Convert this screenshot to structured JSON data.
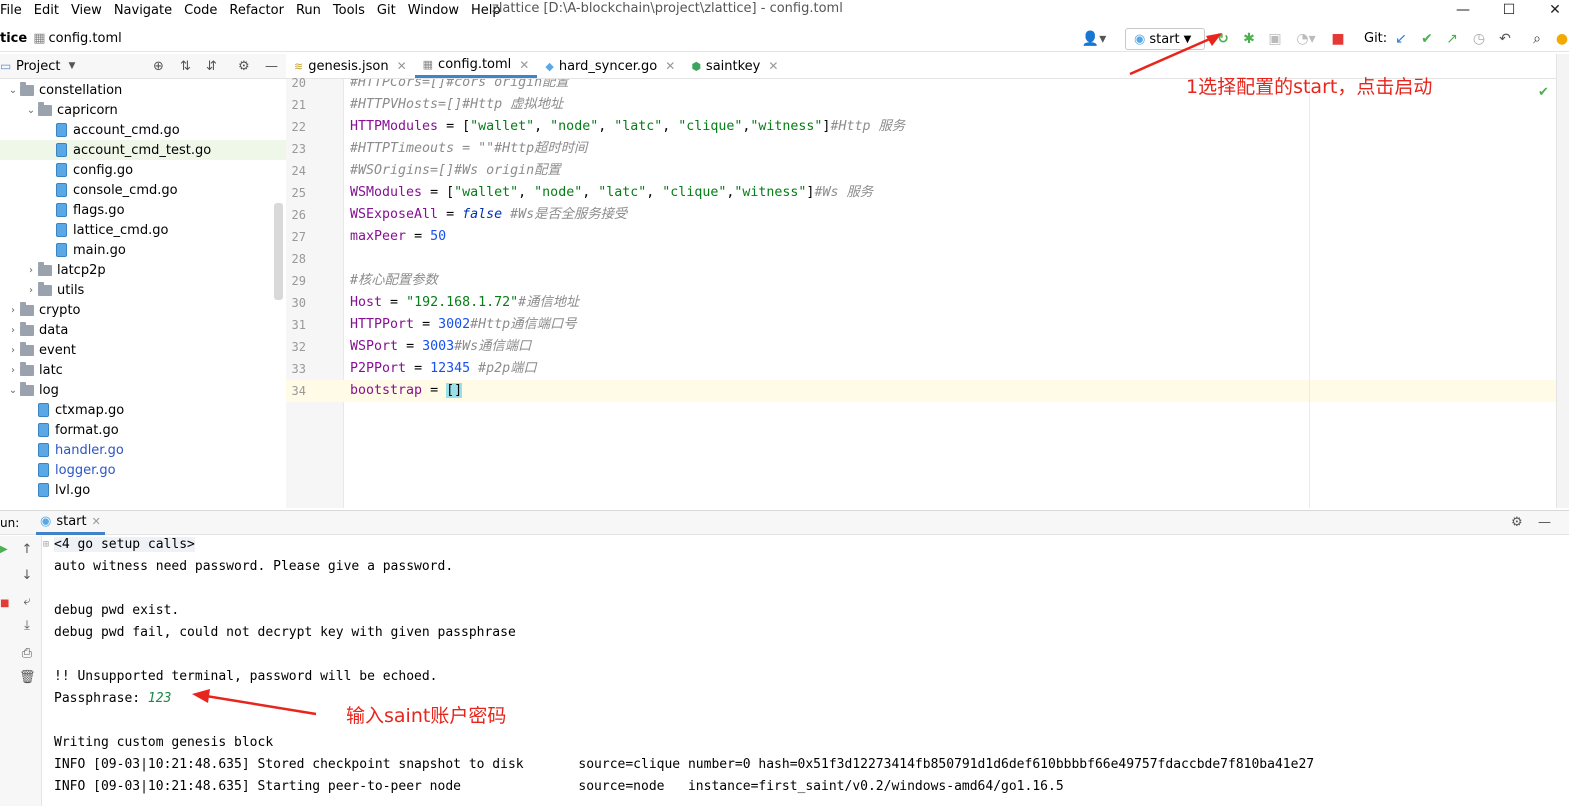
{
  "menu": [
    "File",
    "Edit",
    "View",
    "Navigate",
    "Code",
    "Refactor",
    "Run",
    "Tools",
    "Git",
    "Window",
    "Help"
  ],
  "window_title": "zlattice [D:\\A-blockchain\\project\\zlattice] - config.toml",
  "window_controls": [
    "—",
    "☐",
    "✕"
  ],
  "nav": {
    "project_crumb": "tice",
    "file_crumb": "config.toml"
  },
  "run_config": "start",
  "git_label": "Git:",
  "project_panel": {
    "title": "Project"
  },
  "tree": [
    {
      "label": "constellation",
      "type": "folder",
      "depth": 0,
      "open": true
    },
    {
      "label": "capricorn",
      "type": "folder",
      "depth": 1,
      "open": true
    },
    {
      "label": "account_cmd.go",
      "type": "file",
      "depth": 2
    },
    {
      "label": "account_cmd_test.go",
      "type": "file",
      "depth": 2,
      "selected": true
    },
    {
      "label": "config.go",
      "type": "file",
      "depth": 2
    },
    {
      "label": "console_cmd.go",
      "type": "file",
      "depth": 2
    },
    {
      "label": "flags.go",
      "type": "file",
      "depth": 2
    },
    {
      "label": "lattice_cmd.go",
      "type": "file",
      "depth": 2
    },
    {
      "label": "main.go",
      "type": "file",
      "depth": 2
    },
    {
      "label": "latcp2p",
      "type": "folder",
      "depth": 1,
      "open": false
    },
    {
      "label": "utils",
      "type": "folder",
      "depth": 1,
      "open": false
    },
    {
      "label": "crypto",
      "type": "folder",
      "depth": 0,
      "open": false
    },
    {
      "label": "data",
      "type": "folder",
      "depth": 0,
      "open": false
    },
    {
      "label": "event",
      "type": "folder",
      "depth": 0,
      "open": false
    },
    {
      "label": "latc",
      "type": "folder",
      "depth": 0,
      "open": false
    },
    {
      "label": "log",
      "type": "folder",
      "depth": 0,
      "open": true
    },
    {
      "label": "ctxmap.go",
      "type": "file",
      "depth": 1
    },
    {
      "label": "format.go",
      "type": "file",
      "depth": 1
    },
    {
      "label": "handler.go",
      "type": "file",
      "depth": 1,
      "vcs": true
    },
    {
      "label": "logger.go",
      "type": "file",
      "depth": 1,
      "vcs": true
    },
    {
      "label": "lvl.go",
      "type": "file",
      "depth": 1
    }
  ],
  "tabs": [
    {
      "label": "genesis.json",
      "active": false,
      "closable": true
    },
    {
      "label": "config.toml",
      "active": true,
      "closable": true
    },
    {
      "label": "hard_syncer.go",
      "active": false,
      "closable": true
    },
    {
      "label": "saintkey",
      "active": false,
      "closable": true
    }
  ],
  "code_lines": [
    {
      "n": "20",
      "parts": [
        [
          "c",
          "#HTTPCors=[]#cors origin配置"
        ]
      ]
    },
    {
      "n": "21",
      "parts": [
        [
          "c",
          "#HTTPVHosts=[]#Http 虚拟地址"
        ]
      ]
    },
    {
      "n": "22",
      "parts": [
        [
          "k",
          "HTTPModules"
        ],
        [
          "",
          "= ["
        ],
        [
          "s",
          "\"wallet\""
        ],
        [
          "",
          ", "
        ],
        [
          "s",
          "\"node\""
        ],
        [
          "",
          ", "
        ],
        [
          "s",
          "\"latc\""
        ],
        [
          "",
          ", "
        ],
        [
          "s",
          "\"clique\""
        ],
        [
          "",
          ","
        ],
        [
          "s",
          "\"witness\""
        ],
        [
          "",
          "]"
        ],
        [
          "c",
          "#Http 服务"
        ]
      ]
    },
    {
      "n": "23",
      "parts": [
        [
          "c",
          "#HTTPTimeouts = \"\"#Http超时时间"
        ]
      ]
    },
    {
      "n": "24",
      "parts": [
        [
          "c",
          "#WSOrigins=[]#Ws origin配置"
        ]
      ]
    },
    {
      "n": "25",
      "parts": [
        [
          "k",
          "WSModules"
        ],
        [
          "",
          "= ["
        ],
        [
          "s",
          "\"wallet\""
        ],
        [
          "",
          ", "
        ],
        [
          "s",
          "\"node\""
        ],
        [
          "",
          ", "
        ],
        [
          "s",
          "\"latc\""
        ],
        [
          "",
          ", "
        ],
        [
          "s",
          "\"clique\""
        ],
        [
          "",
          ","
        ],
        [
          "s",
          "\"witness\""
        ],
        [
          "",
          "]"
        ],
        [
          "c",
          "#Ws 服务"
        ]
      ]
    },
    {
      "n": "26",
      "parts": [
        [
          "k",
          "WSExposeAll"
        ],
        [
          "",
          "= "
        ],
        [
          "kw",
          "false"
        ],
        [
          "c",
          " #Ws是否全服务接受"
        ]
      ]
    },
    {
      "n": "27",
      "parts": [
        [
          "k",
          "maxPeer"
        ],
        [
          "",
          "= "
        ],
        [
          "n",
          "50"
        ]
      ]
    },
    {
      "n": "28",
      "parts": []
    },
    {
      "n": "29",
      "parts": [
        [
          "c",
          "#核心配置参数"
        ]
      ]
    },
    {
      "n": "30",
      "parts": [
        [
          "k",
          "Host"
        ],
        [
          "",
          "= "
        ],
        [
          "s",
          "\"192.168.1.72\""
        ],
        [
          "c",
          "#通信地址"
        ]
      ]
    },
    {
      "n": "31",
      "parts": [
        [
          "k",
          "HTTPPort"
        ],
        [
          "",
          "= "
        ],
        [
          "n",
          "3002"
        ],
        [
          "c",
          "#Http通信端口号"
        ]
      ]
    },
    {
      "n": "32",
      "parts": [
        [
          "k",
          "WSPort"
        ],
        [
          "",
          "= "
        ],
        [
          "n",
          "3003"
        ],
        [
          "c",
          "#Ws通信端口"
        ]
      ]
    },
    {
      "n": "33",
      "parts": [
        [
          "k",
          "P2PPort"
        ],
        [
          "",
          "= "
        ],
        [
          "n",
          "12345"
        ],
        [
          "c",
          " #p2p端口"
        ]
      ]
    },
    {
      "n": "34",
      "parts": [
        [
          "k",
          "bootstrap"
        ],
        [
          "",
          "= "
        ],
        [
          "br",
          "[]"
        ]
      ],
      "current": true
    }
  ],
  "run_panel": {
    "label": "un:",
    "tab": "start"
  },
  "console_lines": [
    {
      "parts": [
        [
          "fold",
          "<4 go setup calls>"
        ]
      ]
    },
    {
      "parts": [
        [
          "",
          "auto witness need password. Please give a password."
        ]
      ]
    },
    {
      "parts": []
    },
    {
      "parts": [
        [
          "",
          "debug pwd exist."
        ]
      ]
    },
    {
      "parts": [
        [
          "",
          "debug pwd fail, could not decrypt key with given passphrase"
        ]
      ]
    },
    {
      "parts": []
    },
    {
      "parts": [
        [
          "",
          "!! Unsupported terminal, password will be echoed."
        ]
      ]
    },
    {
      "parts": [
        [
          "",
          "Passphrase: "
        ],
        [
          "ok",
          "123"
        ]
      ]
    },
    {
      "parts": []
    },
    {
      "parts": [
        [
          "",
          "Writing custom genesis block"
        ]
      ]
    },
    {
      "parts": [
        [
          "",
          "INFO [09-03|10:21:48.635] Stored checkpoint snapshot to disk       source=clique number=0 hash=0x51f3d12273414fb850791d1d6def610bbbbf66e49757fdaccbde7f810ba41e27"
        ]
      ]
    },
    {
      "parts": [
        [
          "",
          "INFO [09-03|10:21:48.635] Starting peer-to-peer node               source=node   instance=first_saint/v0.2/windows-amd64/go1.16.5"
        ]
      ]
    }
  ],
  "annotations": {
    "start_hint": "1选择配置的start，点击启动",
    "password_hint": "输入saint账户密码"
  },
  "colors": {
    "annotation": "#e8251c",
    "run_green": "#4caf50",
    "stop_red": "#e53935",
    "selected_row": "#eef7e8",
    "current_line": "#fffbe6"
  }
}
